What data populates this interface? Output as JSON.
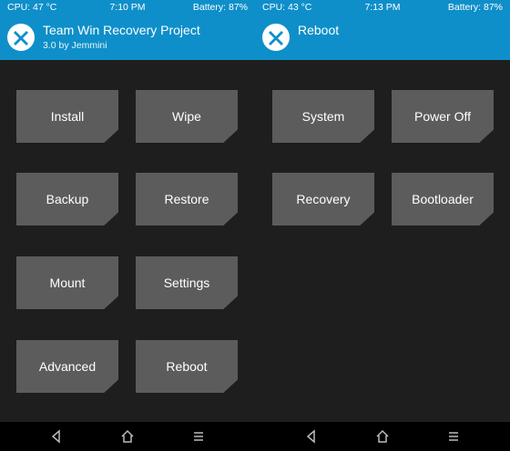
{
  "colors": {
    "accent": "#0e8fc9",
    "button": "#5c5c5c",
    "background": "#1e1e1e",
    "navbar": "#000000"
  },
  "left": {
    "status": {
      "cpu": "CPU: 47 °C",
      "time": "7:10 PM",
      "battery": "Battery: 87%"
    },
    "header": {
      "title": "Team Win Recovery Project",
      "subtitle": "3.0 by Jemmini"
    },
    "buttons": [
      "Install",
      "Wipe",
      "Backup",
      "Restore",
      "Mount",
      "Settings",
      "Advanced",
      "Reboot"
    ]
  },
  "right": {
    "status": {
      "cpu": "CPU: 43 °C",
      "time": "7:13 PM",
      "battery": "Battery: 87%"
    },
    "header": {
      "title": "Reboot"
    },
    "buttons": [
      "System",
      "Power Off",
      "Recovery",
      "Bootloader"
    ]
  },
  "navbar_icons": [
    "back-icon",
    "home-icon",
    "menu-icon"
  ]
}
